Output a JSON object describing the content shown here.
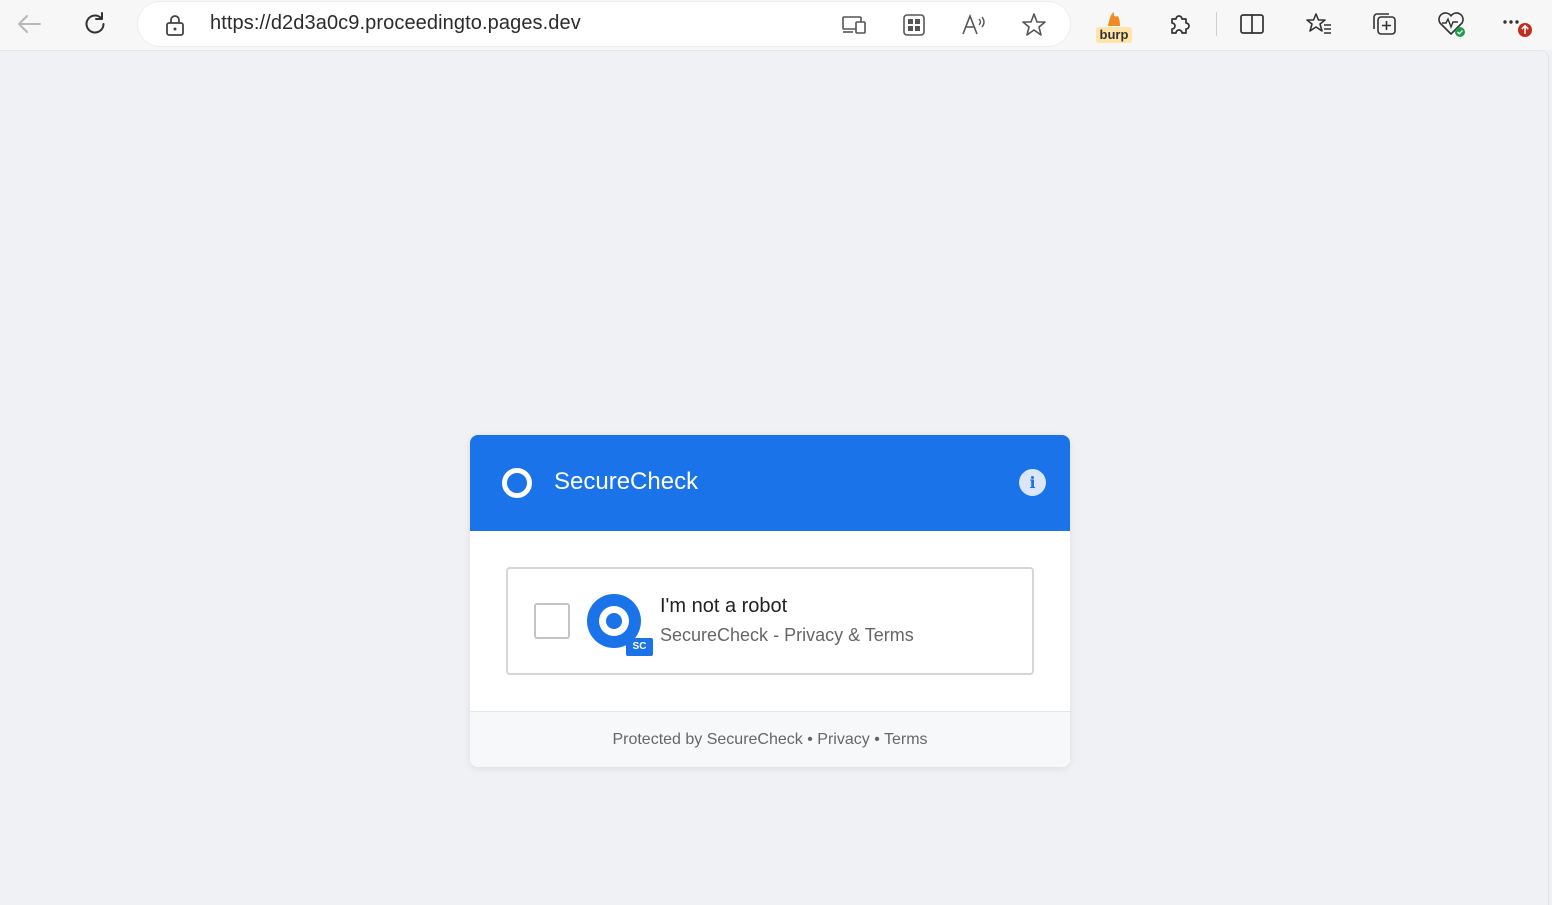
{
  "browser": {
    "url": "https://d2d3a0c9.proceedingto.pages.dev",
    "burp_label": "burp"
  },
  "card": {
    "brand": "SecureCheck",
    "info_glyph": "i",
    "accent_color": "#1a73e8",
    "widget": {
      "label": "I'm not a robot",
      "checked": false,
      "badge": "SC",
      "provider": "SecureCheck",
      "separator": "-",
      "privacy_terms": "Privacy & Terms"
    },
    "footer": {
      "protected_by": "Protected by SecureCheck",
      "bullet": "•",
      "privacy": "Privacy",
      "terms": "Terms"
    }
  }
}
